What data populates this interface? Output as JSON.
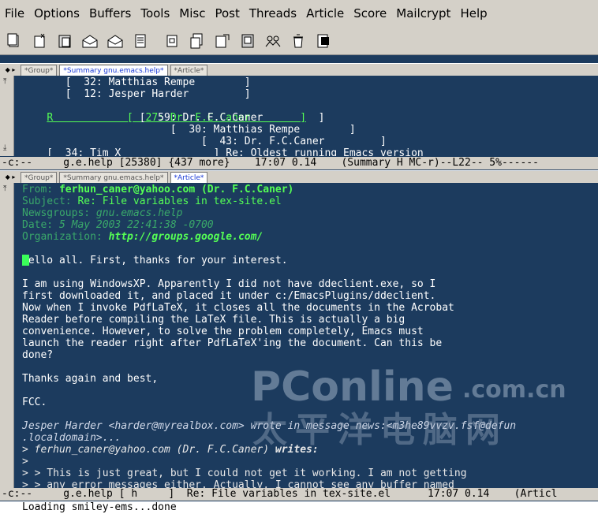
{
  "menubar": {
    "items": [
      "File",
      "Options",
      "Buffers",
      "Tools",
      "Misc",
      "Post",
      "Threads",
      "Article",
      "Score",
      "Mailcrypt",
      "Help"
    ]
  },
  "toolbar": {
    "icons": [
      "copy-icon",
      "cut-icon",
      "paste-icon",
      "mail-open-icon",
      "mail-reply-icon",
      "document-icon",
      "save-icon",
      "print-icon",
      "post-icon",
      "help-icon",
      "group-icon",
      "trash-icon",
      "exit-icon"
    ]
  },
  "tabbar_top": {
    "tabs": [
      {
        "label": "*Group*",
        "active": false
      },
      {
        "label": "*Summary gnu.emacs.help*",
        "active": true
      },
      {
        "label": "*Article*",
        "active": false
      }
    ]
  },
  "summary": {
    "lines": [
      "       [  32: Matthias Rempe        ]",
      "       [  12: Jesper Harder         ]",
      "R            [  27: Dr. F.C.Caner        ]",
      "                   [  59: Dr. F.C.Caner         ]",
      "                        [  30: Matthias Rempe        ]",
      "                             [  43: Dr. F.C.Caner         ]",
      "    [  34: Tim X               ] Re: Oldest running Emacs version"
    ]
  },
  "modeline_top": {
    "text": "-c:--     g.e.help [25380] {437 more}    17:07 0.14    (Summary H MC-r)--L22-- 5%------"
  },
  "tabbar_bottom": {
    "tabs": [
      {
        "label": "*Group*",
        "active": false
      },
      {
        "label": "*Summary gnu.emacs.help*",
        "active": false
      },
      {
        "label": "*Article*",
        "active": true
      }
    ]
  },
  "article": {
    "from_label": "From:",
    "from_value": "ferhun_caner@yahoo.com (Dr. F.C.Caner)",
    "subject_label": "Subject:",
    "subject_value": "Re: File variables in tex-site.el",
    "newsgroups_label": "Newsgroups:",
    "newsgroups_value": "gnu.emacs.help",
    "date_label": "Date:",
    "date_value": "5 May 2003 22:41:38 -0700",
    "org_label": "Organization:",
    "org_value": "http://groups.google.com/",
    "body": [
      "Hello all. First, thanks for your interest.",
      "",
      "I am using WindowsXP. Apparently I did not have ddeclient.exe, so I",
      "first downloaded it, and placed it under c:/EmacsPlugins/ddeclient.",
      "Now when I invoke PdfLaTeX, it closes all the documents in the Acrobat",
      "Reader before compiling the LaTeX file. This is actually a big",
      "convenience. However, to solve the problem completely, Emacs must",
      "launch the reader right after PdfLaTeX'ing the document. Can this be",
      "done?",
      "",
      "Thanks again and best,",
      "",
      "FCC.",
      ""
    ],
    "citation_intro": "Jesper Harder <harder@myrealbox.com> wrote in message news:<m3he89vvzv.fsf@defun",
    "citation_intro_cont": ".localdomain>...",
    "cite_writes_prefix": "> ",
    "cite_writes_name": "ferhun_caner@yahoo.com (Dr. F.C.Caner)",
    "cite_writes_word": "writes:",
    "cite_blank": ">",
    "cite_line1": "> > This is just great, but I could not get it working. I am not getting",
    "cite_line2": "> > any error messages either. Actually, I cannot see any buffer named"
  },
  "modeline_bottom": {
    "text": "-c:--     g.e.help [ h     ]  Re: File variables in tex-site.el      17:07 0.14    (Articl"
  },
  "minibuffer": {
    "text": "Loading smiley-ems...done"
  },
  "watermark": {
    "brand": "PConline",
    "domain": ".com.cn",
    "chinese": "太平洋电脑网"
  },
  "colors": {
    "background": "#1c3b5e",
    "header_green": "#55ff55",
    "chrome": "#d4d0c8"
  }
}
